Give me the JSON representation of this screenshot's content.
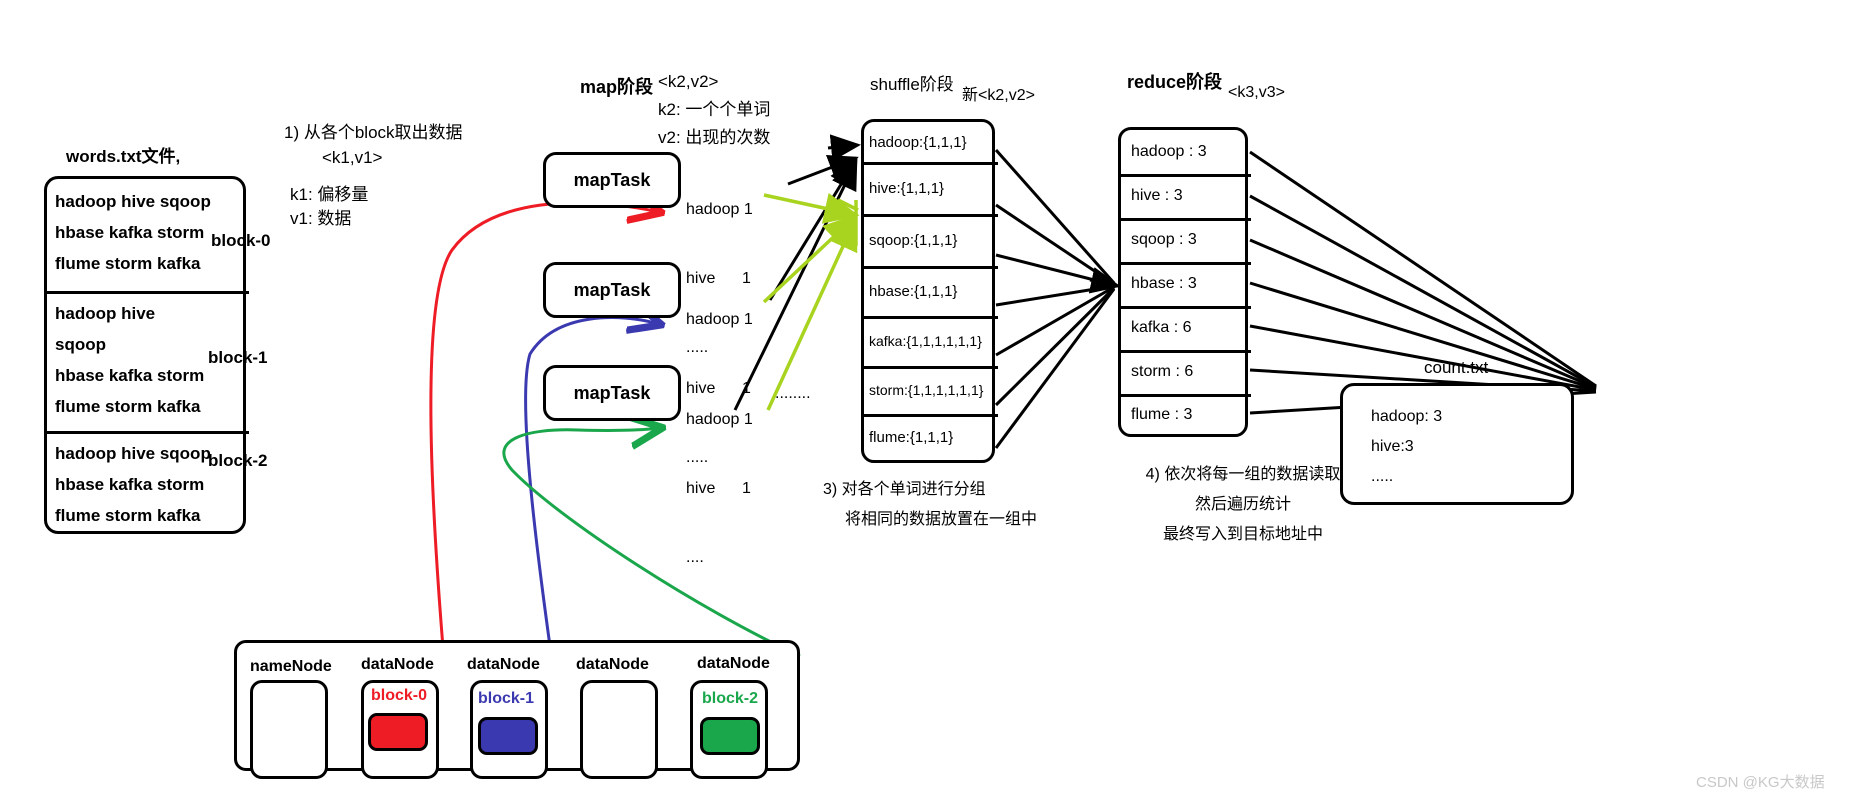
{
  "file": {
    "title": "words.txt文件,",
    "blocks": [
      {
        "label": "block-0",
        "lines": [
          "hadoop  hive  sqoop",
          "hbase kafka  storm",
          "flume storm  kafka"
        ]
      },
      {
        "label": "block-1",
        "lines": [
          "hadoop  hive",
          "sqoop",
          "hbase kafka  storm",
          "flume storm  kafka"
        ]
      },
      {
        "label": "block-2",
        "lines": [
          "hadoop  hive  sqoop",
          "hbase kafka  storm",
          "flume storm  kafka"
        ]
      }
    ]
  },
  "annotation1": {
    "line1": "1)  从各个block取出数据",
    "line2": "<k1,v1>",
    "line3": "k1: 偏移量",
    "line4": "v1: 数据"
  },
  "map_stage": {
    "title": "map阶段",
    "kv": "<k2,v2>",
    "k2": "k2:  一个个单词",
    "v2": "v2:  出现的次数",
    "tasks": [
      {
        "label": "mapTask",
        "out": [
          "hadoop 1",
          "hive      1",
          "....."
        ]
      },
      {
        "label": "mapTask",
        "out": [
          "hadoop 1",
          "hive      1",
          "....."
        ]
      },
      {
        "label": "mapTask",
        "out": [
          "hadoop 1",
          "hive      1",
          "...."
        ]
      }
    ],
    "ellipsis": "........"
  },
  "shuffle_stage": {
    "title": "shuffle阶段",
    "kv": "新<k2,v2>",
    "rows": [
      "hadoop:{1,1,1}",
      "hive:{1,1,1}",
      "sqoop:{1,1,1}",
      "hbase:{1,1,1}",
      "kafka:{1,1,1,1,1,1}",
      "storm:{1,1,1,1,1,1}",
      "flume:{1,1,1}"
    ]
  },
  "reduce_stage": {
    "title": "reduce阶段",
    "kv": "<k3,v3>",
    "rows": [
      "hadoop : 3",
      "hive : 3",
      "sqoop : 3",
      "hbase : 3",
      "kafka : 6",
      "storm : 6",
      "flume : 3"
    ]
  },
  "output": {
    "title": "count.txt",
    "lines": [
      "hadoop: 3",
      "hive:3",
      "....."
    ]
  },
  "annotation3": {
    "line1": "3) 对各个单词进行分组",
    "line2": "将相同的数据放置在一组中"
  },
  "annotation4": {
    "line1": "4) 依次将每一组的数据读取",
    "line2": "然后遍历统计",
    "line3": "最终写入到目标地址中"
  },
  "cluster": {
    "nodes": [
      {
        "label": "nameNode",
        "block": "",
        "color": ""
      },
      {
        "label": "dataNode",
        "block": "block-0",
        "color": "#ee1c25"
      },
      {
        "label": "dataNode",
        "block": "block-1",
        "color": "#3b39b0"
      },
      {
        "label": "dataNode",
        "block": "",
        "color": ""
      },
      {
        "label": "dataNode",
        "block": "block-2",
        "color": "#1aa64b"
      }
    ]
  },
  "colors": {
    "red": "#ee1c25",
    "blue": "#3b39b0",
    "green": "#1aa64b",
    "yellow_green": "#a8d420",
    "black": "#000000",
    "watermark": "#c8c8c8"
  },
  "watermark": "CSDN @KG大数据"
}
